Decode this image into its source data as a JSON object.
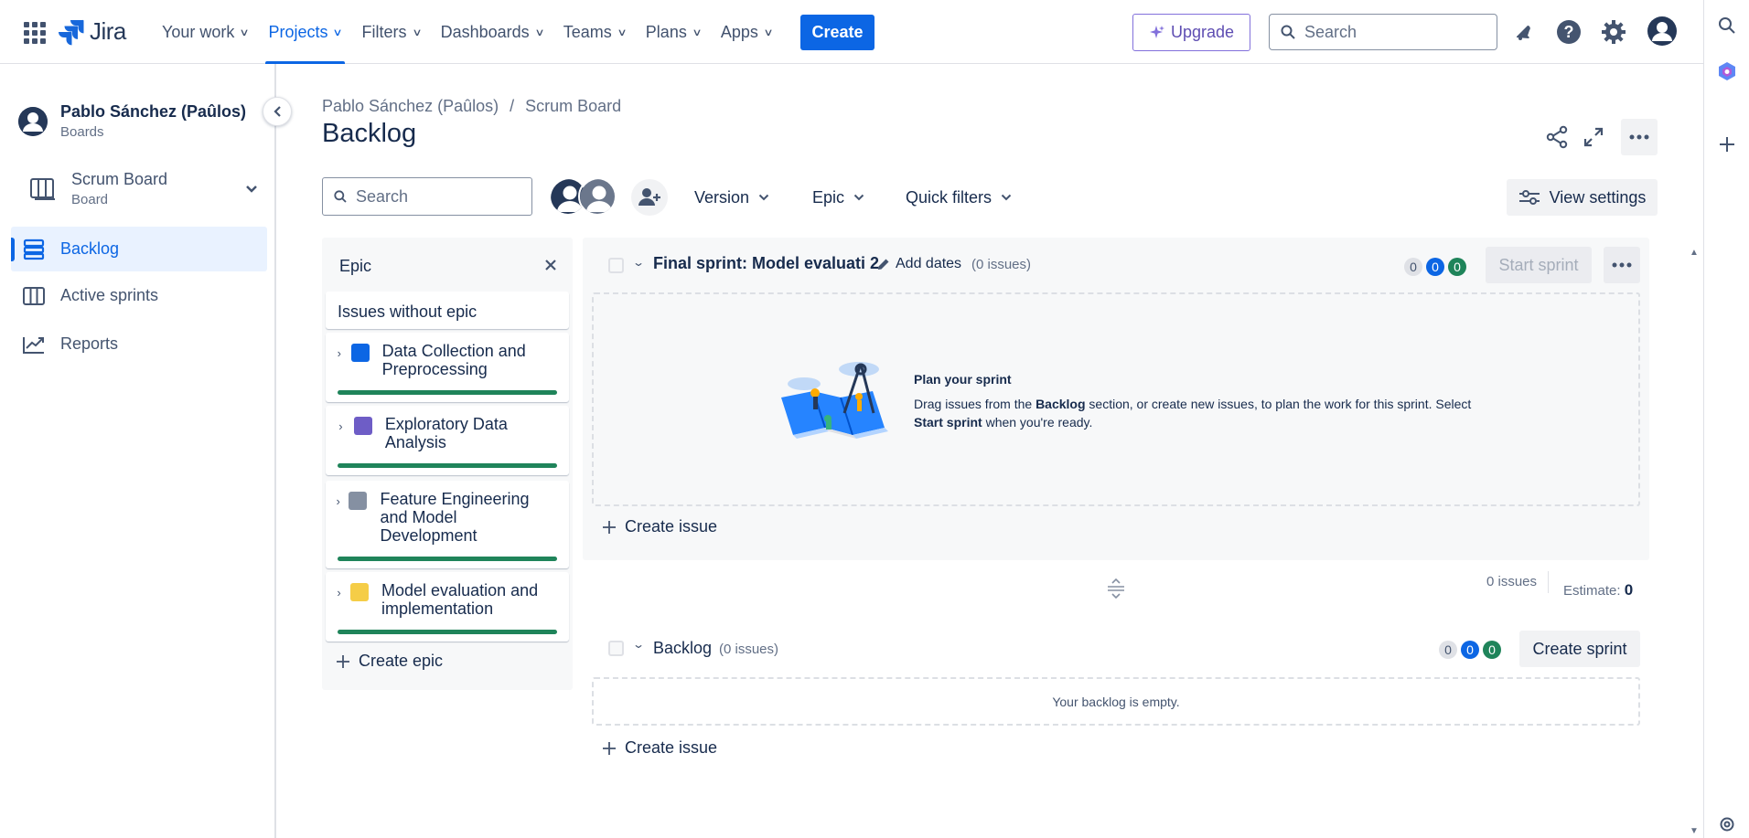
{
  "topnav": {
    "logo_text": "Jira",
    "menu": [
      {
        "label": "Your work",
        "active": false
      },
      {
        "label": "Projects",
        "active": true
      },
      {
        "label": "Filters",
        "active": false
      },
      {
        "label": "Dashboards",
        "active": false
      },
      {
        "label": "Teams",
        "active": false
      },
      {
        "label": "Plans",
        "active": false
      },
      {
        "label": "Apps",
        "active": false
      }
    ],
    "create_label": "Create",
    "upgrade_label": "Upgrade",
    "search_placeholder": "Search",
    "icons": [
      "notifications-icon",
      "help-icon",
      "settings-icon",
      "profile-icon"
    ]
  },
  "sidebar": {
    "project_name": "Pablo Sánchez (Paûlos)",
    "project_sub": "Boards",
    "board_name": "Scrum Board",
    "board_sub": "Board",
    "items": [
      {
        "label": "Backlog",
        "icon": "backlog-icon",
        "active": true
      },
      {
        "label": "Active sprints",
        "icon": "board-columns-icon",
        "active": false
      },
      {
        "label": "Reports",
        "icon": "chart-line-icon",
        "active": false
      }
    ]
  },
  "breadcrumb": [
    "Pablo Sánchez (Paûlos)",
    "/",
    "Scrum Board"
  ],
  "page_title": "Backlog",
  "filters": {
    "search_placeholder": "Search",
    "version_label": "Version",
    "epic_label": "Epic",
    "quick_filters_label": "Quick filters",
    "view_settings_label": "View settings"
  },
  "epic_panel": {
    "title": "Epic",
    "no_epic_label": "Issues without epic",
    "epics": [
      {
        "name": "Data Collection and Preprocessing",
        "color": "#0c66e4",
        "progress": 1.0
      },
      {
        "name": "Exploratory Data Analysis",
        "color": "#6e5dc6",
        "progress": 1.0
      },
      {
        "name": "Feature Engineering and Model Development",
        "color": "#8590a2",
        "progress": 1.0
      },
      {
        "name": "Model evaluation and implementation",
        "color": "#f5cd47",
        "progress": 1.0
      }
    ],
    "create_epic_label": "Create epic"
  },
  "sprint": {
    "name": "Final sprint: Model evaluati 2",
    "add_dates_label": "Add dates",
    "issue_count": "(0 issues)",
    "counts": {
      "todo": "0",
      "in_progress": "0",
      "done": "0"
    },
    "start_label": "Start sprint",
    "empty_title": "Plan your sprint",
    "empty_desc_1": "Drag issues from the ",
    "empty_desc_bold_1": "Backlog",
    "empty_desc_2": " section, or create new issues, to plan the work for this sprint. Select ",
    "empty_desc_bold_2": "Start sprint",
    "empty_desc_3": " when you're ready.",
    "create_issue_label": "Create issue"
  },
  "summary": {
    "issues": "0 issues",
    "estimate_label": "Estimate:",
    "estimate_value": "0"
  },
  "backlog": {
    "name": "Backlog",
    "issue_count": "(0 issues)",
    "counts": {
      "todo": "0",
      "in_progress": "0",
      "done": "0"
    },
    "create_sprint_label": "Create sprint",
    "empty_text": "Your backlog is empty.",
    "create_issue_label": "Create issue"
  },
  "colors": {
    "accent": "#0c66e4",
    "done_green": "#1f845a",
    "upgrade_purple": "#5e4db2"
  }
}
